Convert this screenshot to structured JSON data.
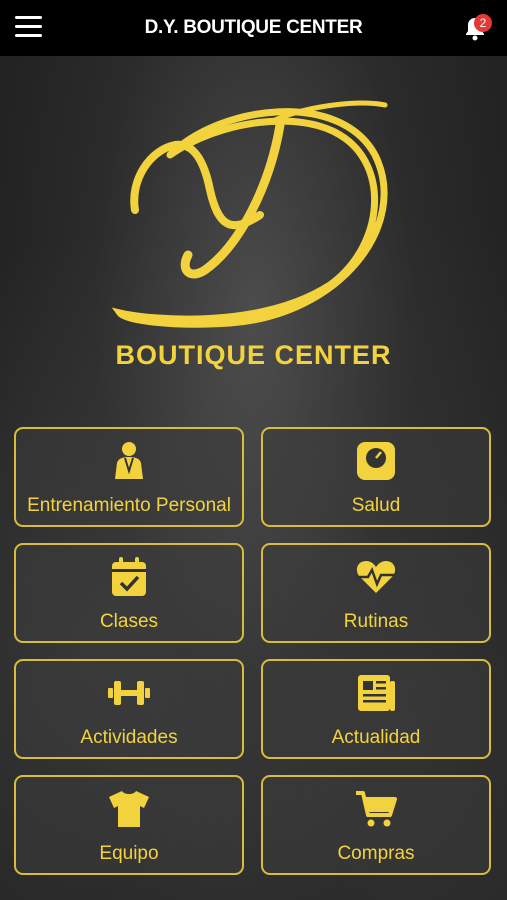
{
  "app": {
    "title": "D.Y. BOUTIQUE CENTER",
    "notifications_count": "2",
    "brand_text": "BOUTIQUE CENTER",
    "accent_color": "#f3d33d"
  },
  "tiles": [
    {
      "label": "Entrenamiento Personal",
      "icon": "personal-trainer-icon"
    },
    {
      "label": "Salud",
      "icon": "scale-icon"
    },
    {
      "label": "Clases",
      "icon": "calendar-check-icon"
    },
    {
      "label": "Rutinas",
      "icon": "heartbeat-icon"
    },
    {
      "label": "Actividades",
      "icon": "dumbbell-icon"
    },
    {
      "label": "Actualidad",
      "icon": "newspaper-icon"
    },
    {
      "label": "Equipo",
      "icon": "tshirt-icon"
    },
    {
      "label": "Compras",
      "icon": "cart-icon"
    }
  ]
}
